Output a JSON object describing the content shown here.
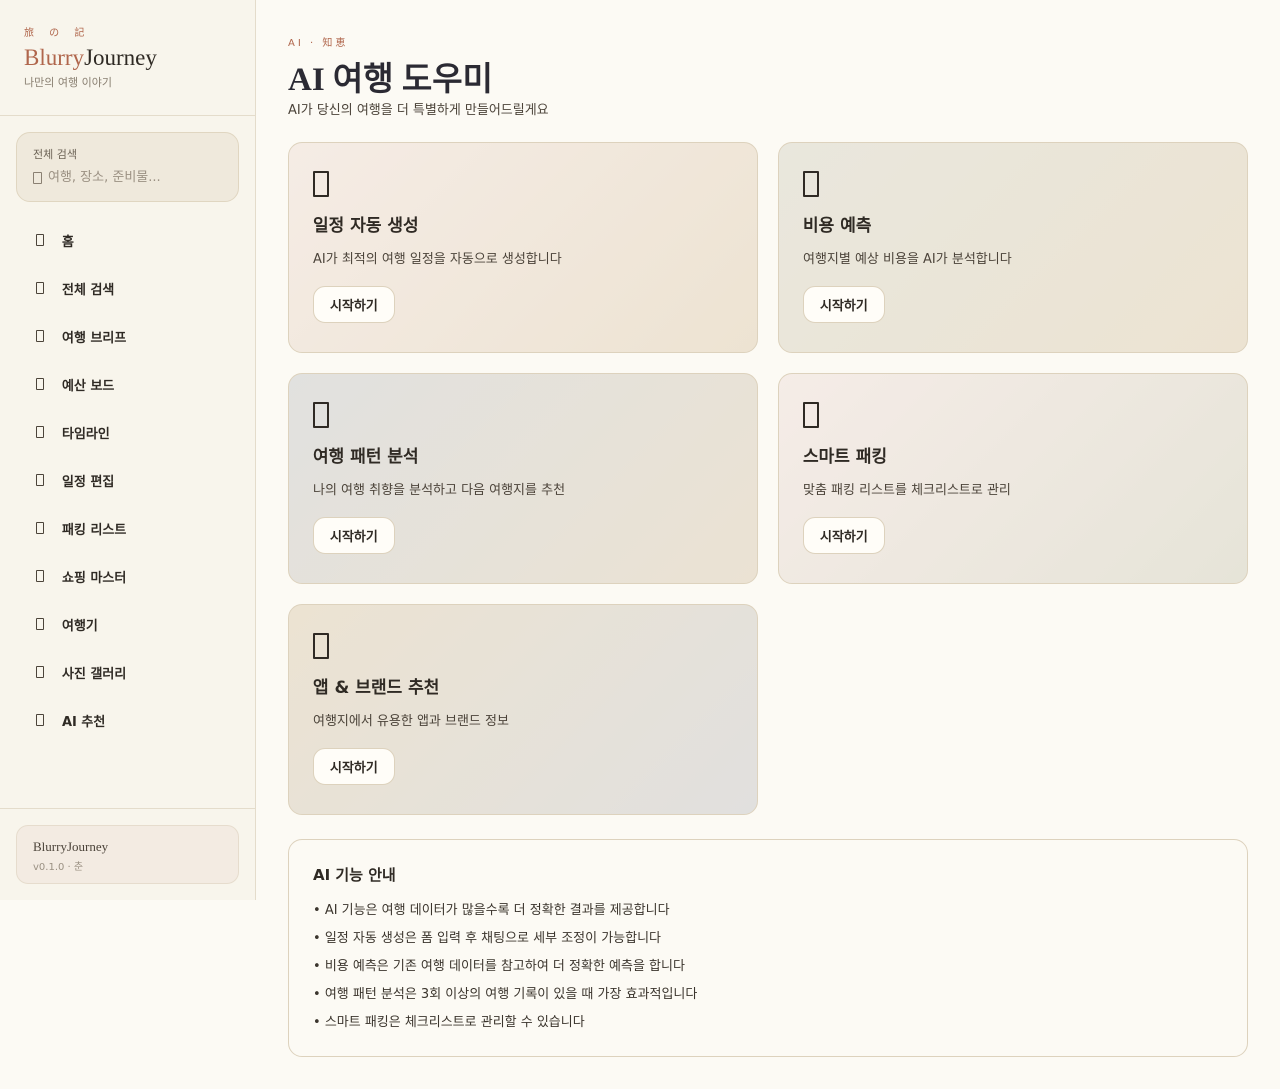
{
  "brand": {
    "kicker": "旅 の 記",
    "name_accent": "Blurry",
    "name_rest": "Journey",
    "tagline": "나만의 여행 이야기"
  },
  "search": {
    "label": "전체 검색",
    "placeholder": "여행, 장소, 준비물...",
    "value": ""
  },
  "nav": {
    "items": [
      {
        "label": "홈",
        "icon": "home-icon"
      },
      {
        "label": "전체 검색",
        "icon": "search-icon"
      },
      {
        "label": "여행 브리프",
        "icon": "brief-icon"
      },
      {
        "label": "예산 보드",
        "icon": "budget-icon"
      },
      {
        "label": "타임라인",
        "icon": "timeline-icon"
      },
      {
        "label": "일정 편집",
        "icon": "edit-icon"
      },
      {
        "label": "패킹 리스트",
        "icon": "packing-icon"
      },
      {
        "label": "쇼핑 마스터",
        "icon": "shopping-icon"
      },
      {
        "label": "여행기",
        "icon": "journal-icon"
      },
      {
        "label": "사진 갤러리",
        "icon": "gallery-icon"
      },
      {
        "label": "AI 추천",
        "icon": "ai-icon"
      }
    ]
  },
  "footer": {
    "name": "BlurryJourney",
    "version": "v0.1.0 · 춘"
  },
  "header": {
    "kicker": "AI · 知恵",
    "title": "AI 여행 도우미",
    "subtitle": "AI가 당신의 여행을 더 특별하게 만들어드릴게요"
  },
  "cards": [
    {
      "title": "일정 자동 생성",
      "desc": "AI가 최적의 여행 일정을 자동으로 생성합니다",
      "button": "시작하기"
    },
    {
      "title": "비용 예측",
      "desc": "여행지별 예상 비용을 AI가 분석합니다",
      "button": "시작하기"
    },
    {
      "title": "여행 패턴 분석",
      "desc": "나의 여행 취향을 분석하고 다음 여행지를 추천",
      "button": "시작하기"
    },
    {
      "title": "스마트 패킹",
      "desc": "맞춤 패킹 리스트를 체크리스트로 관리",
      "button": "시작하기"
    },
    {
      "title": "앱 & 브랜드 추천",
      "desc": "여행지에서 유용한 앱과 브랜드 정보",
      "button": "시작하기"
    }
  ],
  "guide": {
    "title": "AI 기능 안내",
    "items": [
      "AI 기능은 여행 데이터가 많을수록 더 정확한 결과를 제공합니다",
      "일정 자동 생성은 폼 입력 후 채팅으로 세부 조정이 가능합니다",
      "비용 예측은 기존 여행 데이터를 참고하여 더 정확한 예측을 합니다",
      "여행 패턴 분석은 3회 이상의 여행 기록이 있을 때 가장 효과적입니다",
      "스마트 패킹은 체크리스트로 관리할 수 있습니다"
    ]
  },
  "colors": {
    "accent": "#b0664c",
    "background": "#fcfaf4",
    "sidebar": "#f8f5ec"
  }
}
